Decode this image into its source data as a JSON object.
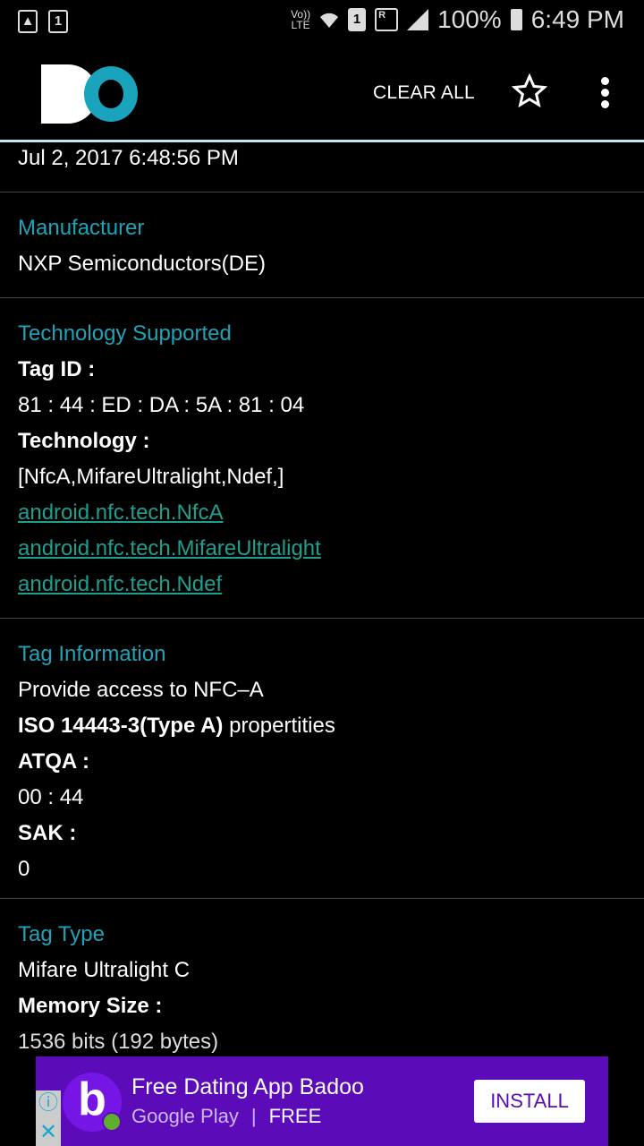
{
  "status_bar": {
    "left_icons": [
      "gallery-icon",
      "calendar-icon"
    ],
    "calendar_day": "1",
    "volte": "Vo))",
    "lte": "LTE",
    "sim": "1",
    "roaming": "R",
    "battery": "100%",
    "time": "6:49 PM"
  },
  "app_bar": {
    "logo": "DO",
    "clear_all": "CLEAR ALL",
    "star_icon": "star-outline-icon",
    "more_icon": "more-vert-icon"
  },
  "colors": {
    "accent": "#1fa3b6",
    "link": "#1f9f8f",
    "ad_bg": "#5b0bb7"
  },
  "sections": {
    "date": "Jul 2, 2017 6:48:56 PM",
    "manufacturer": {
      "title": "Manufacturer",
      "value": "NXP Semiconductors(DE)"
    },
    "technology": {
      "title": "Technology Supported",
      "tag_id_label": "Tag ID :",
      "tag_id": "81 : 44 : ED : DA : 5A : 81 : 04",
      "tech_label": "Technology :",
      "tech_list": "[NfcA,MifareUltralight,Ndef,]",
      "links": [
        "android.nfc.tech.NfcA",
        "android.nfc.tech.MifareUltralight",
        "android.nfc.tech.Ndef"
      ]
    },
    "tag_info": {
      "title": "Tag Information",
      "line1": "Provide access to NFC–A",
      "iso_bold": "ISO 14443-3(Type A)",
      "iso_rest": " propertities",
      "atqa_label": "ATQA :",
      "atqa": "00 : 44",
      "sak_label": "SAK :",
      "sak": "0"
    },
    "tag_type": {
      "title": "Tag Type",
      "value": "Mifare Ultralight C",
      "memory_label": "Memory Size :",
      "memory": "1536 bits (192 bytes)"
    }
  },
  "ad": {
    "title": "Free Dating App Badoo",
    "store": "Google Play",
    "separator": "|",
    "price": "FREE",
    "button": "INSTALL",
    "logo_letter": "b"
  }
}
